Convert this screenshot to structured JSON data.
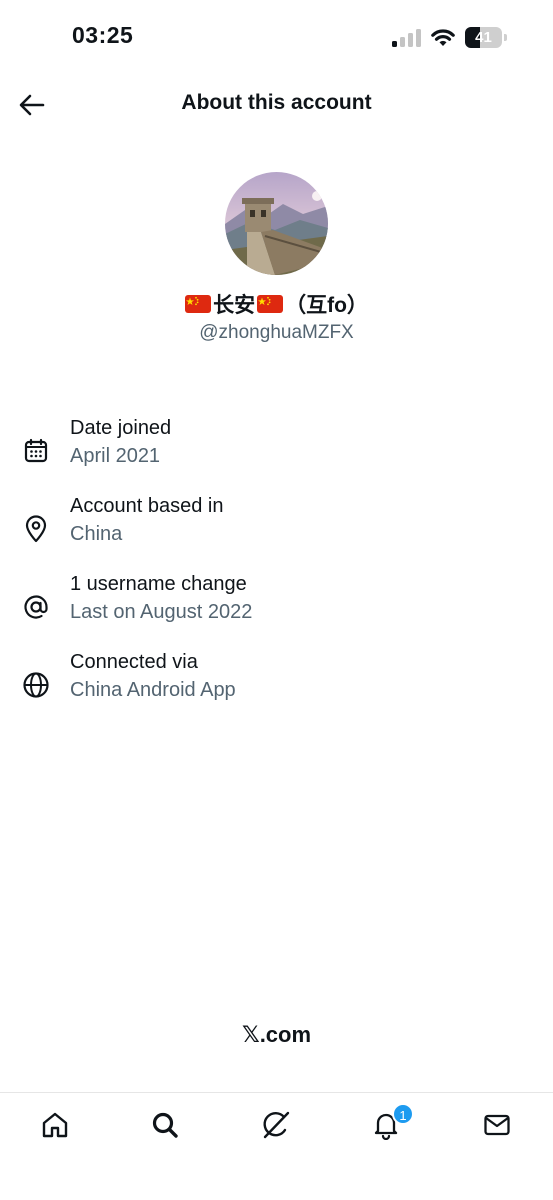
{
  "status_bar": {
    "time": "03:25",
    "battery_level": "41",
    "battery_fraction": 0.41
  },
  "header": {
    "title": "About this account",
    "back_icon": "arrow-left-icon"
  },
  "profile": {
    "name_text": "长安",
    "name_suffix": "（互fo）",
    "flag_icon": "china-flag-icon",
    "handle": "@zhonghuaMZFX"
  },
  "info": [
    {
      "icon": "calendar-icon",
      "label": "Date joined",
      "value": "April 2021"
    },
    {
      "icon": "location-pin-icon",
      "label": "Account based in",
      "value": "China"
    },
    {
      "icon": "at-sign-icon",
      "label": "1 username change",
      "value": "Last on August 2022"
    },
    {
      "icon": "globe-icon",
      "label": "Connected via",
      "value": "China Android App"
    }
  ],
  "footer": {
    "brand_mark": "𝕏",
    "brand_suffix": ".com"
  },
  "bottom_nav": {
    "items": [
      "home-icon",
      "search-icon",
      "grok-icon",
      "notifications-icon",
      "messages-icon"
    ],
    "notification_count": "1"
  },
  "colors": {
    "text_primary": "#0f1419",
    "text_secondary": "#536471",
    "badge_blue": "#1d9bf0",
    "flag_red": "#de2910",
    "flag_yellow": "#ffde00"
  }
}
